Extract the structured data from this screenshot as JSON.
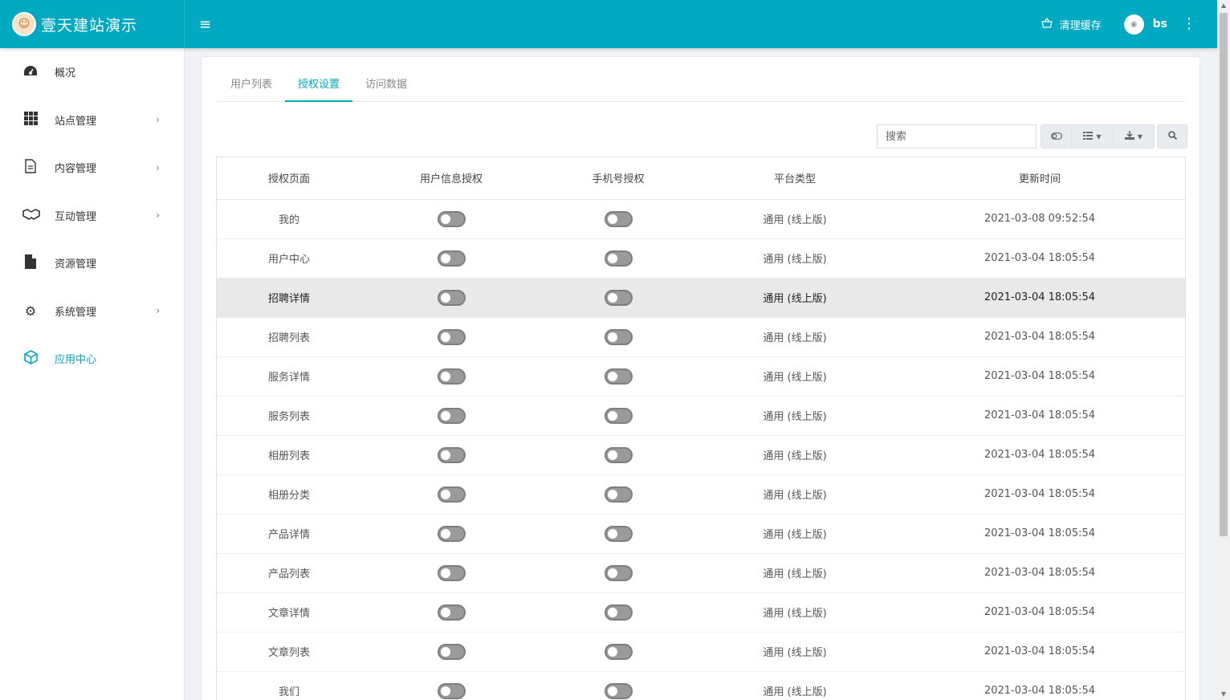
{
  "app": {
    "title": "壹天建站演示",
    "logo_icon": "logo-icon"
  },
  "header": {
    "clear_cache_label": "清理缓存",
    "username": "bs"
  },
  "sidebar": {
    "items": [
      {
        "label": "概况",
        "icon": "dashboard-icon",
        "chevron": false,
        "active": false
      },
      {
        "label": "站点管理",
        "icon": "grid-icon",
        "chevron": true,
        "active": false
      },
      {
        "label": "内容管理",
        "icon": "document-icon",
        "chevron": true,
        "active": false
      },
      {
        "label": "互动管理",
        "icon": "handshake-icon",
        "chevron": true,
        "active": false
      },
      {
        "label": "资源管理",
        "icon": "file-icon",
        "chevron": false,
        "active": false
      },
      {
        "label": "系统管理",
        "icon": "gear-icon",
        "chevron": true,
        "active": false
      },
      {
        "label": "应用中心",
        "icon": "cube-icon",
        "chevron": false,
        "active": true
      }
    ]
  },
  "tabs": [
    {
      "label": "用户列表",
      "active": false
    },
    {
      "label": "授权设置",
      "active": true
    },
    {
      "label": "访问数据",
      "active": false
    }
  ],
  "search": {
    "placeholder": "搜索"
  },
  "table": {
    "columns": [
      "授权页面",
      "用户信息授权",
      "手机号授权",
      "平台类型",
      "更新时间"
    ],
    "rows": [
      {
        "page": "我的",
        "user_info_auth": false,
        "phone_auth": false,
        "platform": "通用 (线上版)",
        "updated": "2021-03-08 09:52:54"
      },
      {
        "page": "用户中心",
        "user_info_auth": false,
        "phone_auth": false,
        "platform": "通用 (线上版)",
        "updated": "2021-03-04 18:05:54"
      },
      {
        "page": "招聘详情",
        "user_info_auth": false,
        "phone_auth": false,
        "platform": "通用 (线上版)",
        "updated": "2021-03-04 18:05:54"
      },
      {
        "page": "招聘列表",
        "user_info_auth": false,
        "phone_auth": false,
        "platform": "通用 (线上版)",
        "updated": "2021-03-04 18:05:54"
      },
      {
        "page": "服务详情",
        "user_info_auth": false,
        "phone_auth": false,
        "platform": "通用 (线上版)",
        "updated": "2021-03-04 18:05:54"
      },
      {
        "page": "服务列表",
        "user_info_auth": false,
        "phone_auth": false,
        "platform": "通用 (线上版)",
        "updated": "2021-03-04 18:05:54"
      },
      {
        "page": "相册列表",
        "user_info_auth": false,
        "phone_auth": false,
        "platform": "通用 (线上版)",
        "updated": "2021-03-04 18:05:54"
      },
      {
        "page": "相册分类",
        "user_info_auth": false,
        "phone_auth": false,
        "platform": "通用 (线上版)",
        "updated": "2021-03-04 18:05:54"
      },
      {
        "page": "产品详情",
        "user_info_auth": false,
        "phone_auth": false,
        "platform": "通用 (线上版)",
        "updated": "2021-03-04 18:05:54"
      },
      {
        "page": "产品列表",
        "user_info_auth": false,
        "phone_auth": false,
        "platform": "通用 (线上版)",
        "updated": "2021-03-04 18:05:54"
      },
      {
        "page": "文章详情",
        "user_info_auth": false,
        "phone_auth": false,
        "platform": "通用 (线上版)",
        "updated": "2021-03-04 18:05:54"
      },
      {
        "page": "文章列表",
        "user_info_auth": false,
        "phone_auth": false,
        "platform": "通用 (线上版)",
        "updated": "2021-03-04 18:05:54"
      },
      {
        "page": "我们",
        "user_info_auth": false,
        "phone_auth": false,
        "platform": "通用 (线上版)",
        "updated": "2021-03-04 18:05:54"
      }
    ]
  },
  "colors": {
    "accent": "#00a9c2"
  }
}
